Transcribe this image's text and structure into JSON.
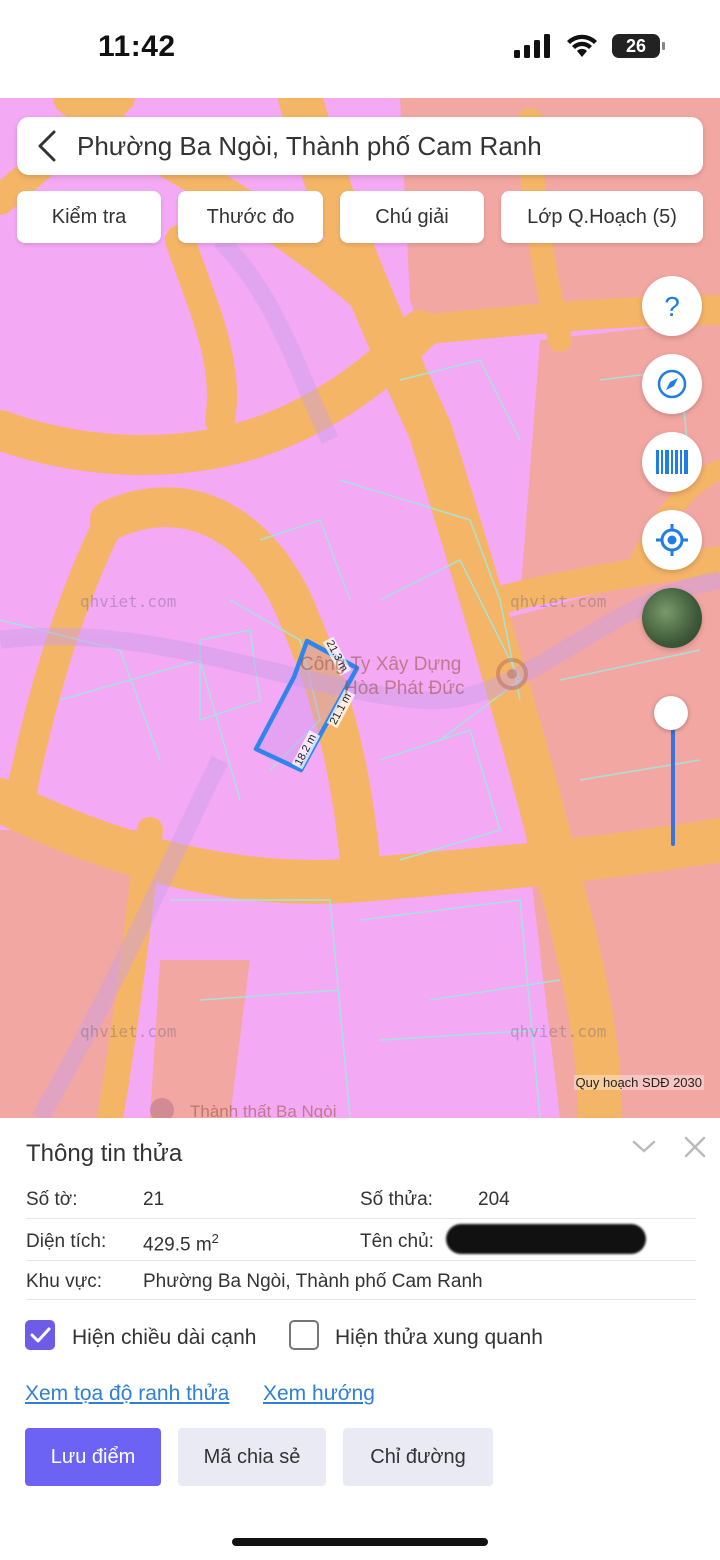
{
  "status_bar": {
    "time": "11:42",
    "battery": "26"
  },
  "header": {
    "title": "Phường Ba Ngòi, Thành phố Cam Ranh"
  },
  "toolbar": {
    "check": "Kiểm tra",
    "ruler": "Thước đo",
    "legend": "Chú giải",
    "layers": "Lớp Q.Hoạch (5)"
  },
  "map": {
    "watermark": "qhviet.com",
    "poi_label_1": "Công Ty Xây Dựng",
    "poi_label_2": "Hòa Phát Đức",
    "bottom_label": "Thành thất Ba Ngòi",
    "credit": "Quy hoạch SDĐ 2030",
    "edge_1": "21.3 m",
    "edge_2": "21.1 m",
    "edge_3": "18.2 m",
    "colors": {
      "residential": "#f4a9f4",
      "road": "#f5b567",
      "commercial": "#f3a7a2",
      "parcel": "#2f84f0"
    }
  },
  "panel": {
    "title": "Thông tin thửa",
    "sheet_label": "Số tờ:",
    "sheet_value": "21",
    "parcel_label": "Số thửa:",
    "parcel_value": "204",
    "area_label": "Diện tích:",
    "area_value": "429.5 m",
    "area_unit_sup": "2",
    "owner_label": "Tên chủ:",
    "region_label": "Khu vực:",
    "region_value": "Phường Ba Ngòi, Thành phố Cam Ranh",
    "show_edges_label": "Hiện chiều dài cạnh",
    "show_edges_checked": true,
    "show_neighbors_label": "Hiện thửa xung quanh",
    "show_neighbors_checked": false,
    "link_coords": "Xem tọa độ ranh thửa",
    "link_direction": "Xem hướng",
    "btn_save": "Lưu điểm",
    "btn_share": "Mã chia sẻ",
    "btn_route": "Chỉ đường"
  }
}
